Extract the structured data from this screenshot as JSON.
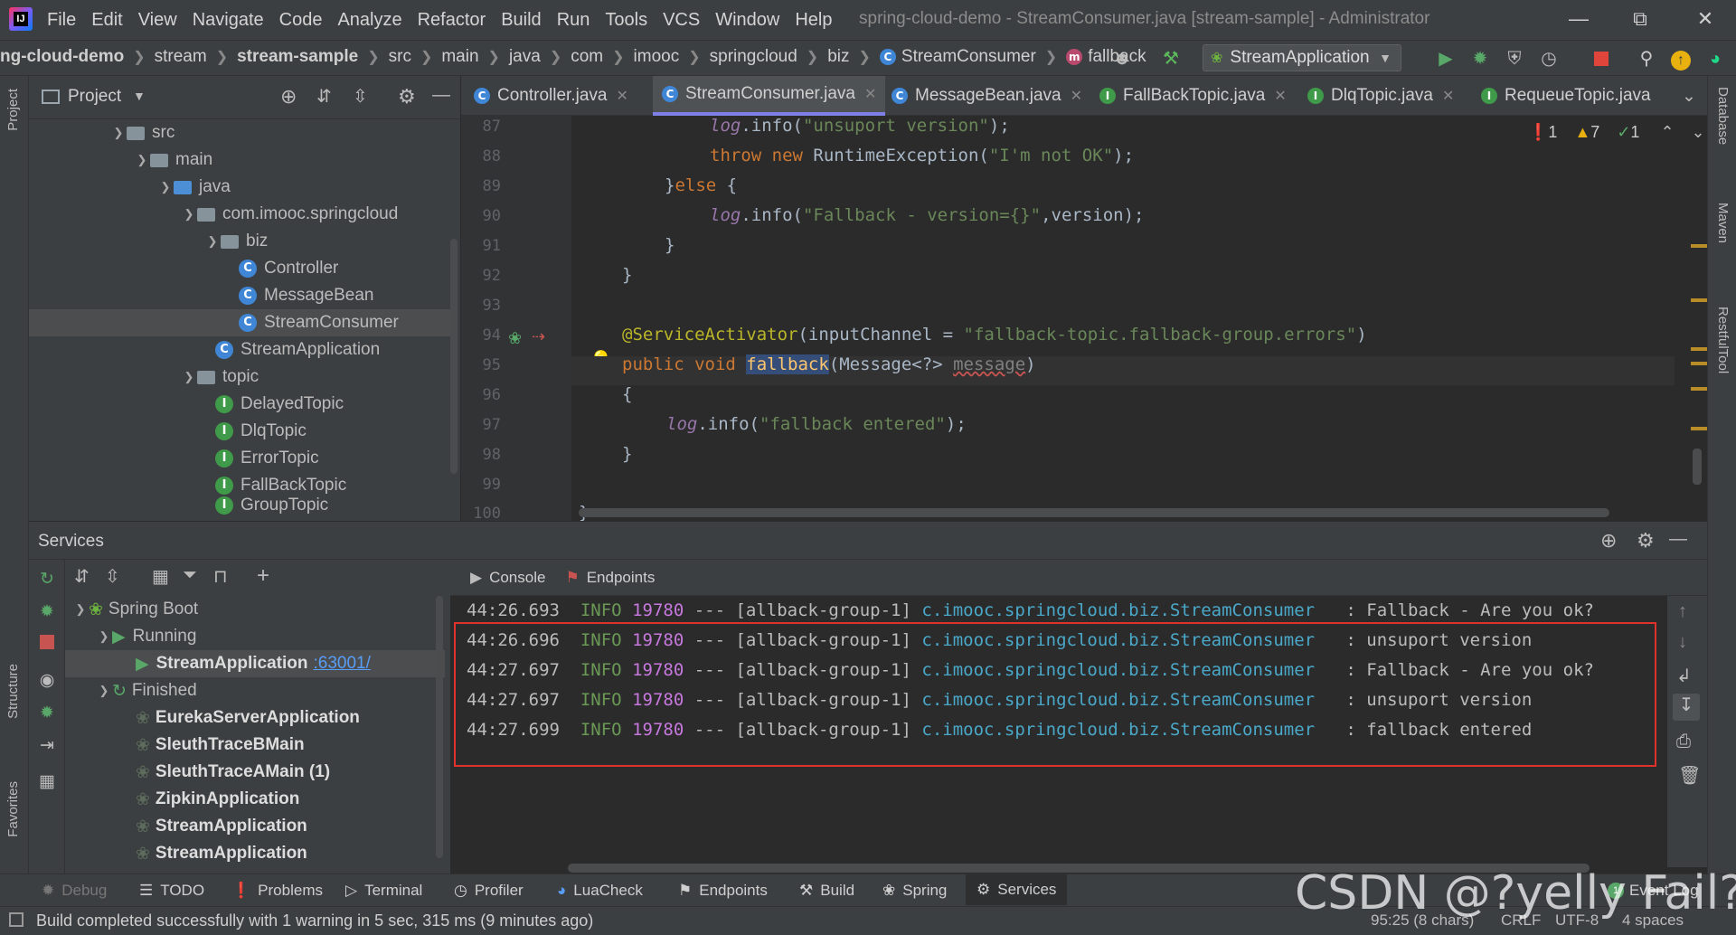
{
  "app": {
    "window_title": "spring-cloud-demo - StreamConsumer.java [stream-sample] - Administrator",
    "menu": [
      "File",
      "Edit",
      "View",
      "Navigate",
      "Code",
      "Analyze",
      "Refactor",
      "Build",
      "Run",
      "Tools",
      "VCS",
      "Window",
      "Help"
    ]
  },
  "breadcrumb": [
    "ng-cloud-demo",
    "stream",
    "stream-sample",
    "src",
    "main",
    "java",
    "com",
    "imooc",
    "springcloud",
    "biz",
    "StreamConsumer",
    "fallback"
  ],
  "run_config": "StreamApplication",
  "left_stripe": {
    "project": "Project",
    "structure": "Structure",
    "favorites": "Favorites"
  },
  "right_stripe": {
    "database": "Database",
    "maven": "Maven",
    "restful": "RestfulTool"
  },
  "project_panel": {
    "title": "Project",
    "tree": [
      {
        "label": "src",
        "type": "folder"
      },
      {
        "label": "main",
        "type": "folder"
      },
      {
        "label": "java",
        "type": "folder-blue"
      },
      {
        "label": "com.imooc.springcloud",
        "type": "package"
      },
      {
        "label": "biz",
        "type": "package"
      },
      {
        "label": "Controller",
        "type": "class"
      },
      {
        "label": "MessageBean",
        "type": "class"
      },
      {
        "label": "StreamConsumer",
        "type": "class"
      },
      {
        "label": "StreamApplication",
        "type": "class"
      },
      {
        "label": "topic",
        "type": "package"
      },
      {
        "label": "DelayedTopic",
        "type": "interface"
      },
      {
        "label": "DlqTopic",
        "type": "interface"
      },
      {
        "label": "ErrorTopic",
        "type": "interface"
      },
      {
        "label": "FallBackTopic",
        "type": "interface"
      },
      {
        "label": "GroupTopic",
        "type": "interface"
      }
    ]
  },
  "editor": {
    "tabs": [
      "Controller.java",
      "StreamConsumer.java",
      "MessageBean.java",
      "FallBackTopic.java",
      "DlqTopic.java",
      "RequeueTopic.java"
    ],
    "active_tab": "StreamConsumer.java",
    "inspections": {
      "errors": "1",
      "warnings": "7",
      "ok": "1"
    },
    "line_numbers": [
      "87",
      "88",
      "89",
      "90",
      "91",
      "92",
      "93",
      "94",
      "95",
      "96",
      "97",
      "98",
      "99",
      "100"
    ],
    "code": {
      "l87_a": "log",
      "l87_b": ".info(",
      "l87_c": "\"unsuport version\"",
      "l87_d": ");",
      "l88_a": "throw new ",
      "l88_b": "RuntimeException(",
      "l88_c": "\"I'm not OK\"",
      "l88_d": ");",
      "l89_a": "}",
      "l89_b": "else ",
      "l89_c": "{",
      "l90_a": "log",
      "l90_b": ".info(",
      "l90_c": "\"Fallback - version={}\"",
      "l90_d": ",version);",
      "l91": "}",
      "l92": "}",
      "l94_a": "@ServiceActivator",
      "l94_b": "(inputChannel = ",
      "l94_c": "\"fallback-topic.fallback-group.errors\"",
      "l94_d": ")",
      "l95_a": "public void ",
      "l95_b": "fallback",
      "l95_c": "(Message<?> ",
      "l95_d": "message",
      "l95_e": ")",
      "l96": "{",
      "l97_a": "log",
      "l97_b": ".info(",
      "l97_c": "\"fallback entered\"",
      "l97_d": ");",
      "l98": "}",
      "l100": "}"
    }
  },
  "services": {
    "title": "Services",
    "tree": {
      "root": "Spring Boot",
      "running": "Running",
      "running_app": "StreamApplication",
      "running_port": ":63001/",
      "finished": "Finished",
      "finished_apps": [
        "EurekaServerApplication",
        "SleuthTraceBMain",
        "SleuthTraceAMain (1)",
        "ZipkinApplication",
        "StreamApplication",
        "StreamApplication"
      ]
    },
    "console_tabs": [
      "Console",
      "Endpoints"
    ],
    "log": [
      {
        "time": "44:26.693",
        "level": "INFO",
        "pid": "19780",
        "thread": "--- [allback-group-1]",
        "logger": "c.imooc.springcloud.biz.StreamConsumer",
        "msg": "  : Fallback - Are you ok?"
      },
      {
        "time": "44:26.696",
        "level": "INFO",
        "pid": "19780",
        "thread": "--- [allback-group-1]",
        "logger": "c.imooc.springcloud.biz.StreamConsumer",
        "msg": "  : unsuport version"
      },
      {
        "time": "44:27.697",
        "level": "INFO",
        "pid": "19780",
        "thread": "--- [allback-group-1]",
        "logger": "c.imooc.springcloud.biz.StreamConsumer",
        "msg": "  : Fallback - Are you ok?"
      },
      {
        "time": "44:27.697",
        "level": "INFO",
        "pid": "19780",
        "thread": "--- [allback-group-1]",
        "logger": "c.imooc.springcloud.biz.StreamConsumer",
        "msg": "  : unsuport version"
      },
      {
        "time": "44:27.699",
        "level": "INFO",
        "pid": "19780",
        "thread": "--- [allback-group-1]",
        "logger": "c.imooc.springcloud.biz.StreamConsumer",
        "msg": "  : fallback entered"
      }
    ]
  },
  "bottom_tools": [
    "Debug",
    "TODO",
    "Problems",
    "Terminal",
    "Profiler",
    "LuaCheck",
    "Endpoints",
    "Build",
    "Spring",
    "Services"
  ],
  "event_log": "Event Log",
  "status": {
    "message": "Build completed successfully with 1 warning in 5 sec, 315 ms (9 minutes ago)",
    "position": "95:25 (8 chars)",
    "line_sep": "CRLF",
    "encoding": "UTF-8",
    "indent": "4 spaces"
  },
  "watermark": "CSDN @?yelly Fail?",
  "colors": {
    "accent": "#7f7fe8",
    "highlight_box": "#e0312c",
    "string": "#6a8759",
    "keyword": "#cc7832"
  }
}
